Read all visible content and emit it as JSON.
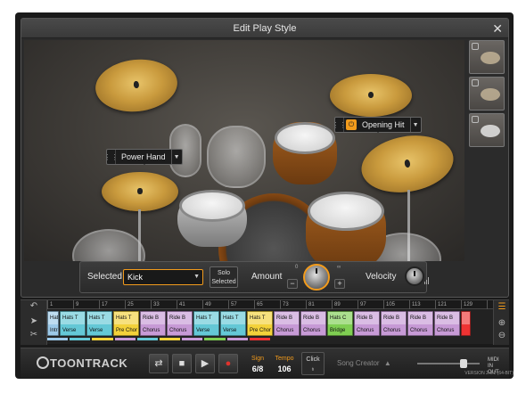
{
  "dialog": {
    "title": "Edit Play Style",
    "close_icon": "close-icon"
  },
  "callouts": {
    "left": {
      "label": "Power Hand"
    },
    "right": {
      "label": "Opening Hit"
    }
  },
  "controls": {
    "selected_label": "Selected",
    "selected_value": "Kick",
    "solo_label": "Solo\nSelected",
    "amount_label": "Amount",
    "amount_minus": "−",
    "amount_plus": "+",
    "amount_min": "0",
    "amount_max": "∞",
    "velocity_label": "Velocity"
  },
  "ruler": {
    "marks": [
      "1",
      "9",
      "17",
      "25",
      "33",
      "41",
      "49",
      "57",
      "65",
      "73",
      "81",
      "89",
      "97",
      "105",
      "113",
      "121",
      "129",
      ""
    ]
  },
  "tracks": [
    {
      "a": "Hats T",
      "b": "Intro",
      "color": "#9cc9e8"
    },
    {
      "a": "Hats T",
      "b": "Verse",
      "color": "#64c8d6"
    },
    {
      "a": "Hats T",
      "b": "Verse",
      "color": "#64c8d6"
    },
    {
      "a": "Hats T",
      "b": "Pre Chor",
      "color": "#f3d23a"
    },
    {
      "a": "Ride B",
      "b": "Chorus",
      "color": "#c79ad6"
    },
    {
      "a": "Ride B",
      "b": "Chorus",
      "color": "#c79ad6"
    },
    {
      "a": "Hats T",
      "b": "Verse",
      "color": "#64c8d6"
    },
    {
      "a": "Hats T",
      "b": "Verse",
      "color": "#64c8d6"
    },
    {
      "a": "Hats T",
      "b": "Pre Chor",
      "color": "#f3d23a"
    },
    {
      "a": "Ride B",
      "b": "Chorus",
      "color": "#c79ad6"
    },
    {
      "a": "Ride B",
      "b": "Chorus",
      "color": "#c79ad6"
    },
    {
      "a": "Hats C",
      "b": "Bridge",
      "color": "#7fce52"
    },
    {
      "a": "Ride B",
      "b": "Chorus",
      "color": "#c79ad6"
    },
    {
      "a": "Ride B",
      "b": "Chorus",
      "color": "#c79ad6"
    },
    {
      "a": "Ride B",
      "b": "Chorus",
      "color": "#c79ad6"
    },
    {
      "a": "Ride B",
      "b": "Chorus",
      "color": "#c79ad6"
    },
    {
      "a": "",
      "b": "",
      "color": "#e33"
    }
  ],
  "transport": {
    "logo": "TOONTRACK",
    "sign_label": "Sign",
    "sign_value": "6/8",
    "tempo_label": "Tempo",
    "tempo_value": "106",
    "click_label": "Click",
    "song_creator_label": "Song Creator",
    "midi_in": "MIDI",
    "midi_out": "IN\nOUT"
  },
  "version": "VERSION 2.0.2 (64-BIT)",
  "colors": {
    "accent": "#f29b1c",
    "record": "#e0322c"
  }
}
